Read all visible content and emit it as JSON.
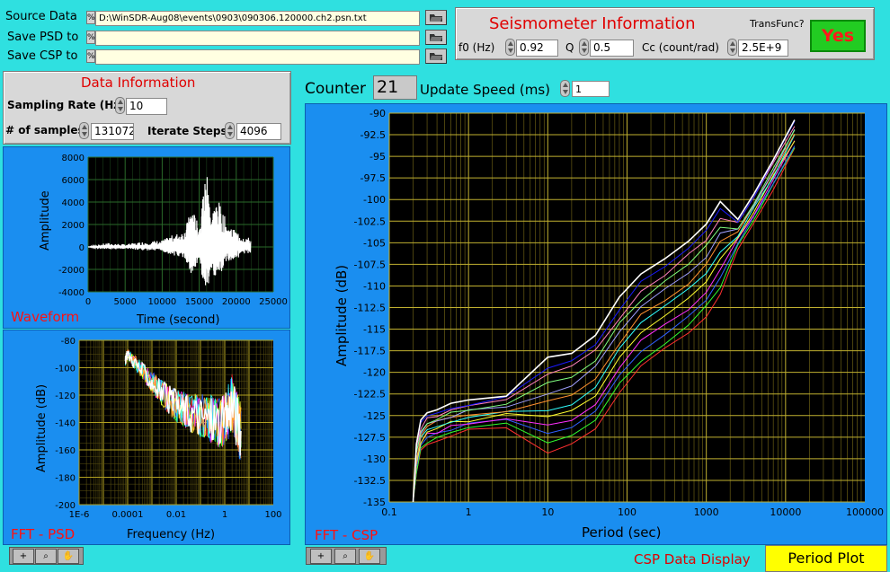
{
  "files": {
    "source_label": "Source Data",
    "source_path": "D:\\WinSDR-Aug08\\events\\0903\\090306.120000.ch2.psn.txt",
    "psd_label": "Save PSD to",
    "psd_path": "",
    "csp_label": "Save CSP to",
    "csp_path": "",
    "path_indicator": "%"
  },
  "seismometer": {
    "title": "Seismometer Information",
    "transfunc_label": "TransFunc?",
    "transfunc_value": "Yes",
    "f0_label": "f0 (Hz)",
    "f0_value": "0.92",
    "q_label": "Q",
    "q_value": "0.5",
    "cc_label": "Cc (count/rad)",
    "cc_value": "2.5E+9"
  },
  "data_info": {
    "title": "Data Information",
    "sampling_label": "Sampling Rate (Hz)",
    "sampling_value": "10",
    "samples_label": "# of samples",
    "samples_value": "131072",
    "iterate_label": "Iterate Steps",
    "iterate_value": "4096"
  },
  "counter": {
    "label": "Counter",
    "value": "21",
    "speed_label": "Update Speed (ms)",
    "speed_value": "1"
  },
  "colors": {
    "background": "#2fe0e0",
    "panel_blue": "#1a8ef0",
    "yes_green": "#22cc22",
    "title_red": "#e00000",
    "grid_green": "#2a6a2a",
    "grid_yellow": "#b0a020"
  },
  "chart_data": [
    {
      "type": "line",
      "caption": "Waveform",
      "xlabel": "Time (second)",
      "ylabel": "Amplitude",
      "xlim": [
        0,
        25000
      ],
      "ylim": [
        -4000,
        8000
      ],
      "xticks": [
        "0",
        "5000",
        "10000",
        "15000",
        "20000",
        "25000"
      ],
      "yticks": [
        "8000",
        "6000",
        "4000",
        "2000",
        "0",
        "-2000",
        "-4000"
      ],
      "x": [
        0,
        2500,
        5000,
        7500,
        10000,
        11500,
        13000,
        14000,
        15000,
        16000,
        16500,
        17500,
        19000,
        20000,
        22000
      ],
      "y": [
        0,
        300,
        200,
        400,
        500,
        900,
        1200,
        3000,
        1500,
        5800,
        2500,
        3600,
        1500,
        1200,
        600
      ],
      "grid": true
    },
    {
      "type": "line",
      "caption": "FFT - PSD",
      "xlabel": "Frequency (Hz)",
      "ylabel": "Amplitude (dB)",
      "xscale": "log",
      "xlim": [
        1e-06,
        100
      ],
      "ylim": [
        -200,
        -80
      ],
      "xticks": [
        "1E-6",
        "0.0001",
        "0.01",
        "1",
        "100"
      ],
      "yticks": [
        "-80",
        "-100",
        "-120",
        "-140",
        "-160",
        "-180",
        "-200"
      ],
      "x": [
        8e-05,
        0.0001,
        0.0003,
        0.001,
        0.003,
        0.01,
        0.03,
        0.1,
        0.3,
        1,
        2,
        5
      ],
      "y": [
        -95,
        -90,
        -100,
        -110,
        -120,
        -128,
        -132,
        -135,
        -138,
        -140,
        -125,
        -150
      ],
      "grid": true
    },
    {
      "type": "line",
      "caption": "FFT - CSP",
      "xlabel": "Period (sec)",
      "ylabel": "Amplitude (dB)",
      "xscale": "log",
      "xlim": [
        0.1,
        100000
      ],
      "ylim": [
        -135,
        -90
      ],
      "xticks": [
        "0.1",
        "1",
        "10",
        "100",
        "1000",
        "10000",
        "100000"
      ],
      "yticks": [
        "-90",
        "-92.5",
        "-95",
        "-97.5",
        "-100",
        "-102.5",
        "-105",
        "-107.5",
        "-110",
        "-112.5",
        "-115",
        "-117.5",
        "-120",
        "-122.5",
        "-125",
        "-127.5",
        "-130",
        "-132.5",
        "-135"
      ],
      "x": [
        0.2,
        0.22,
        0.25,
        0.3,
        0.4,
        0.6,
        1,
        3,
        10,
        20,
        40,
        80,
        150,
        300,
        600,
        1000,
        1500,
        2500,
        4000,
        7000,
        13000
      ],
      "y": [
        -135,
        -130,
        -127.5,
        -126.5,
        -126,
        -125.5,
        -125,
        -124.5,
        -123.8,
        -123,
        -121,
        -117,
        -114,
        -112,
        -110,
        -108,
        -105.5,
        -104,
        -101,
        -97,
        -92.5
      ],
      "grid": true
    }
  ],
  "display": {
    "csp_label": "CSP Data Display",
    "mode_label": "Period Plot"
  },
  "tools": {
    "cursor": "+",
    "zoom": "⌕",
    "hand": "✋"
  }
}
